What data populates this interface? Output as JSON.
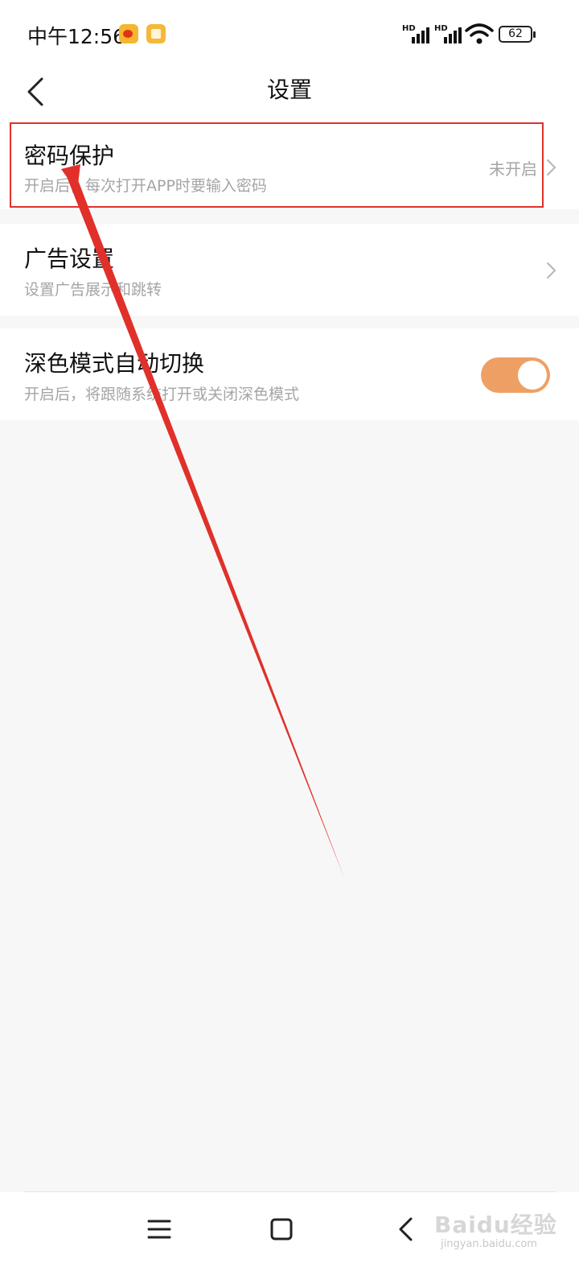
{
  "status_bar": {
    "time": "中午12:56",
    "signal_1_label": "HD",
    "signal_2_label": "HD",
    "battery": "62"
  },
  "header": {
    "title": "设置",
    "back_icon": "chevron-left-icon"
  },
  "settings": [
    {
      "title": "密码保护",
      "subtitle": "开启后，每次打开APP时要输入密码",
      "status": "未开启",
      "control": "chevron"
    },
    {
      "title": "广告设置",
      "subtitle": "设置广告展示和跳转",
      "control": "chevron"
    },
    {
      "title": "深色模式自动切换",
      "subtitle": "开启后，将跟随系统打开或关闭深色模式",
      "control": "toggle",
      "toggle_on": true
    }
  ],
  "nav": {
    "menu_icon": "menu-icon",
    "home_icon": "home-square-icon",
    "back_icon": "back-chevron-icon"
  },
  "watermark": {
    "brand": "Baidu经验",
    "url": "jingyan.baidu.com"
  },
  "colors": {
    "accent": "#eea064",
    "annotation": "#e1302a",
    "background": "#f7f7f7"
  }
}
